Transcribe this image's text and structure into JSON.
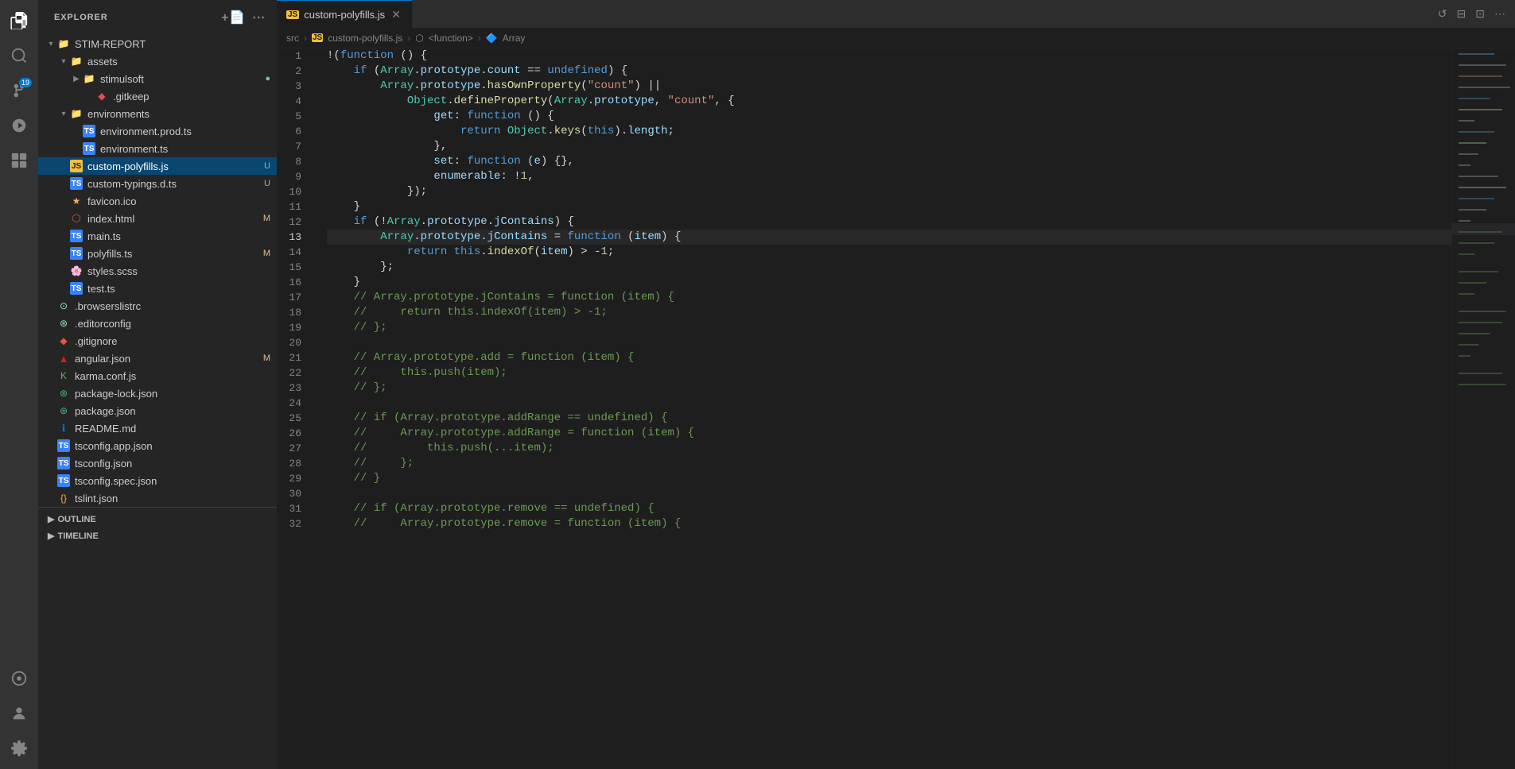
{
  "activityBar": {
    "icons": [
      {
        "name": "files-icon",
        "symbol": "⧉",
        "active": true,
        "badge": null
      },
      {
        "name": "search-icon",
        "symbol": "🔍",
        "active": false,
        "badge": null
      },
      {
        "name": "source-control-icon",
        "symbol": "⎇",
        "active": false,
        "badge": "19"
      },
      {
        "name": "run-debug-icon",
        "symbol": "▷",
        "active": false,
        "badge": null
      },
      {
        "name": "extensions-icon",
        "symbol": "⊞",
        "active": false,
        "badge": null
      },
      {
        "name": "remote-icon",
        "symbol": "⊙",
        "active": false,
        "badge": null
      }
    ],
    "bottomIcons": [
      {
        "name": "accounts-icon",
        "symbol": "👤"
      },
      {
        "name": "settings-icon",
        "symbol": "⚙"
      }
    ]
  },
  "sidebar": {
    "title": "EXPLORER",
    "rootName": "STIM-REPORT",
    "items": [
      {
        "id": "assets",
        "label": "assets",
        "type": "folder",
        "indent": 2,
        "expanded": true,
        "badge": null
      },
      {
        "id": "stimulsoft",
        "label": "stimulsoft",
        "type": "folder",
        "indent": 3,
        "expanded": false,
        "badge": "●"
      },
      {
        "id": "gitkeep",
        "label": ".gitkeep",
        "type": "diamond",
        "indent": 4,
        "badge": null
      },
      {
        "id": "environments",
        "label": "environments",
        "type": "folder",
        "indent": 2,
        "expanded": true,
        "badge": null
      },
      {
        "id": "env-prod",
        "label": "environment.prod.ts",
        "type": "ts",
        "indent": 3,
        "badge": null
      },
      {
        "id": "env",
        "label": "environment.ts",
        "type": "ts",
        "indent": 3,
        "badge": null
      },
      {
        "id": "custom-polyfills",
        "label": "custom-polyfills.js",
        "type": "js",
        "indent": 2,
        "badge": "U",
        "active": true
      },
      {
        "id": "custom-typings",
        "label": "custom-typings.d.ts",
        "type": "ts",
        "indent": 2,
        "badge": "U"
      },
      {
        "id": "favicon",
        "label": "favicon.ico",
        "type": "favicon",
        "indent": 2,
        "badge": null
      },
      {
        "id": "index-html",
        "label": "index.html",
        "type": "html",
        "indent": 2,
        "badge": "M"
      },
      {
        "id": "main-ts",
        "label": "main.ts",
        "type": "ts",
        "indent": 2,
        "badge": null
      },
      {
        "id": "polyfills",
        "label": "polyfills.ts",
        "type": "ts",
        "indent": 2,
        "badge": "M"
      },
      {
        "id": "styles-scss",
        "label": "styles.scss",
        "type": "scss",
        "indent": 2,
        "badge": null
      },
      {
        "id": "test-ts",
        "label": "test.ts",
        "type": "ts",
        "indent": 2,
        "badge": null
      },
      {
        "id": "browserslistrc",
        "label": ".browserslistrc",
        "type": "browserslist",
        "indent": 1,
        "badge": null
      },
      {
        "id": "editorconfig",
        "label": ".editorconfig",
        "type": "editor",
        "indent": 1,
        "badge": null
      },
      {
        "id": "gitignore",
        "label": ".gitignore",
        "type": "git",
        "indent": 1,
        "badge": null
      },
      {
        "id": "angular-json",
        "label": "angular.json",
        "type": "angular",
        "indent": 1,
        "badge": "M"
      },
      {
        "id": "karma-conf",
        "label": "karma.conf.js",
        "type": "karma",
        "indent": 1,
        "badge": null
      },
      {
        "id": "package-lock",
        "label": "package-lock.json",
        "type": "json",
        "indent": 1,
        "badge": null
      },
      {
        "id": "package-json",
        "label": "package.json",
        "type": "json",
        "indent": 1,
        "badge": null
      },
      {
        "id": "readme",
        "label": "README.md",
        "type": "md",
        "indent": 1,
        "badge": null
      },
      {
        "id": "tsconfig-app",
        "label": "tsconfig.app.json",
        "type": "ts",
        "indent": 1,
        "badge": null
      },
      {
        "id": "tsconfig",
        "label": "tsconfig.json",
        "type": "ts",
        "indent": 1,
        "badge": null
      },
      {
        "id": "tsconfig-spec",
        "label": "tsconfig.spec.json",
        "type": "ts",
        "indent": 1,
        "badge": null
      },
      {
        "id": "tslint",
        "label": "tslint.json",
        "type": "json-braces",
        "indent": 1,
        "badge": null
      }
    ],
    "outline": "OUTLINE",
    "timeline": "TIMELINE"
  },
  "editor": {
    "tabs": [
      {
        "label": "custom-polyfills.js",
        "type": "js",
        "active": true,
        "modified": true
      }
    ],
    "breadcrumb": {
      "path": [
        "src",
        "custom-polyfills.js",
        "<function>",
        "Array"
      ]
    },
    "filename": "custom-polyfills.js",
    "lines": [
      {
        "n": 1,
        "code": "!(function () {"
      },
      {
        "n": 2,
        "code": "    if (Array.prototype.count == undefined) {"
      },
      {
        "n": 3,
        "code": "        Array.prototype.hasOwnProperty(\"count\") ||"
      },
      {
        "n": 4,
        "code": "            Object.defineProperty(Array.prototype, \"count\", {"
      },
      {
        "n": 5,
        "code": "                get: function () {"
      },
      {
        "n": 6,
        "code": "                    return Object.keys(this).length;"
      },
      {
        "n": 7,
        "code": "                },"
      },
      {
        "n": 8,
        "code": "                set: function (e) {},"
      },
      {
        "n": 9,
        "code": "                enumerable: !1,"
      },
      {
        "n": 10,
        "code": "            });"
      },
      {
        "n": 11,
        "code": "    }"
      },
      {
        "n": 12,
        "code": "    if (!Array.prototype.jContains) {"
      },
      {
        "n": 13,
        "code": "        Array.prototype.jContains = function (item) {"
      },
      {
        "n": 14,
        "code": "            return this.indexOf(item) > -1;"
      },
      {
        "n": 15,
        "code": "        };"
      },
      {
        "n": 16,
        "code": "    }"
      },
      {
        "n": 17,
        "code": "    // Array.prototype.jContains = function (item) {"
      },
      {
        "n": 18,
        "code": "    //     return this.indexOf(item) > -1;"
      },
      {
        "n": 19,
        "code": "    // };"
      },
      {
        "n": 20,
        "code": ""
      },
      {
        "n": 21,
        "code": "    // Array.prototype.add = function (item) {"
      },
      {
        "n": 22,
        "code": "    //     this.push(item);"
      },
      {
        "n": 23,
        "code": "    // };"
      },
      {
        "n": 24,
        "code": ""
      },
      {
        "n": 25,
        "code": "    // if (Array.prototype.addRange == undefined) {"
      },
      {
        "n": 26,
        "code": "    //     Array.prototype.addRange = function (item) {"
      },
      {
        "n": 27,
        "code": "    //         this.push(...item);"
      },
      {
        "n": 28,
        "code": "    //     };"
      },
      {
        "n": 29,
        "code": "    // }"
      },
      {
        "n": 30,
        "code": ""
      },
      {
        "n": 31,
        "code": "    // if (Array.prototype.remove == undefined) {"
      },
      {
        "n": 32,
        "code": "    //     Array.prototype.remove = function (item) {"
      }
    ]
  },
  "topBar": {
    "moreIcon": "⋯",
    "historyIcon": "↺",
    "splitIcon": "⊟",
    "layoutIcon": "⊡",
    "moreActionsIcon": "⋯"
  }
}
